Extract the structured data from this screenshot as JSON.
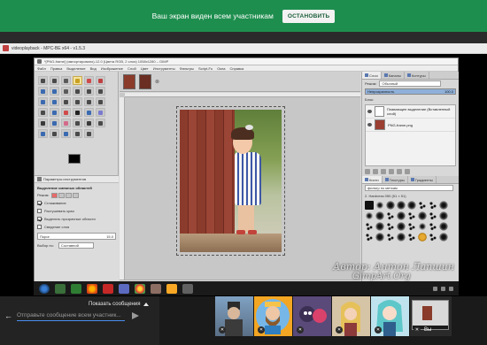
{
  "share_banner": {
    "message": "Ваш экран виден всем участникам",
    "stop_label": "ОСТАНОВИТЬ"
  },
  "player": {
    "title": "videoplayback - MPC-BE x64 - v1.5.3"
  },
  "gimp": {
    "title": "*[PNG-frame] (импортировано)-12.0 (Цвета RGB, 2 слоя) 1058x1280 – GIMP",
    "menu": [
      "Файл",
      "Правка",
      "Выделение",
      "Вид",
      "Изображение",
      "Слой",
      "Цвет",
      "Инструменты",
      "Фильтры",
      "Script-Fu",
      "Окна",
      "Справка"
    ],
    "tool_options": {
      "tab": "Параметры инструментов",
      "heading": "Выделение смежных областей",
      "mode_label": "Режим:",
      "antialias": "Сглаживание",
      "feather": "Растушевать края",
      "transparent": "Выделять прозрачные области",
      "sample_merged": "Сведение слоя",
      "threshold_label": "Порог",
      "threshold_value": "15.0",
      "select_by_label": "Выбор по:",
      "select_by_value": "Составной"
    },
    "status": {
      "zoom": "29,6%",
      "message": "Плавающее выделение"
    },
    "layers": {
      "tabs": [
        "Слои",
        "Каналы",
        "Контуры"
      ],
      "mode_label": "Режим:",
      "mode_value": "Обычный",
      "opacity_label": "Непрозрачность",
      "opacity_value": "100.0",
      "lock_label": "Блок:",
      "items": [
        {
          "name": "Плавающее выделение (Вставленный слой)"
        },
        {
          "name": "PNG-frame.png"
        }
      ]
    },
    "brushes": {
      "tabs": [
        "Кисти",
        "Текстуры",
        "Градиенты"
      ],
      "filter_label": "фильтр по меткам",
      "current": "2. Hardness 050 (51 × 51)"
    }
  },
  "watermark": {
    "author": "Автор: Антон Лапшин",
    "site": "GimpArt.Org"
  },
  "meeting": {
    "show_messages": "Показать сообщения",
    "chat_placeholder": "Отправьте сообщение всем участник...",
    "self_label": "Вы"
  },
  "colors": {
    "banner": "#1e8e4e",
    "input_accent": "#4a8cf0"
  }
}
